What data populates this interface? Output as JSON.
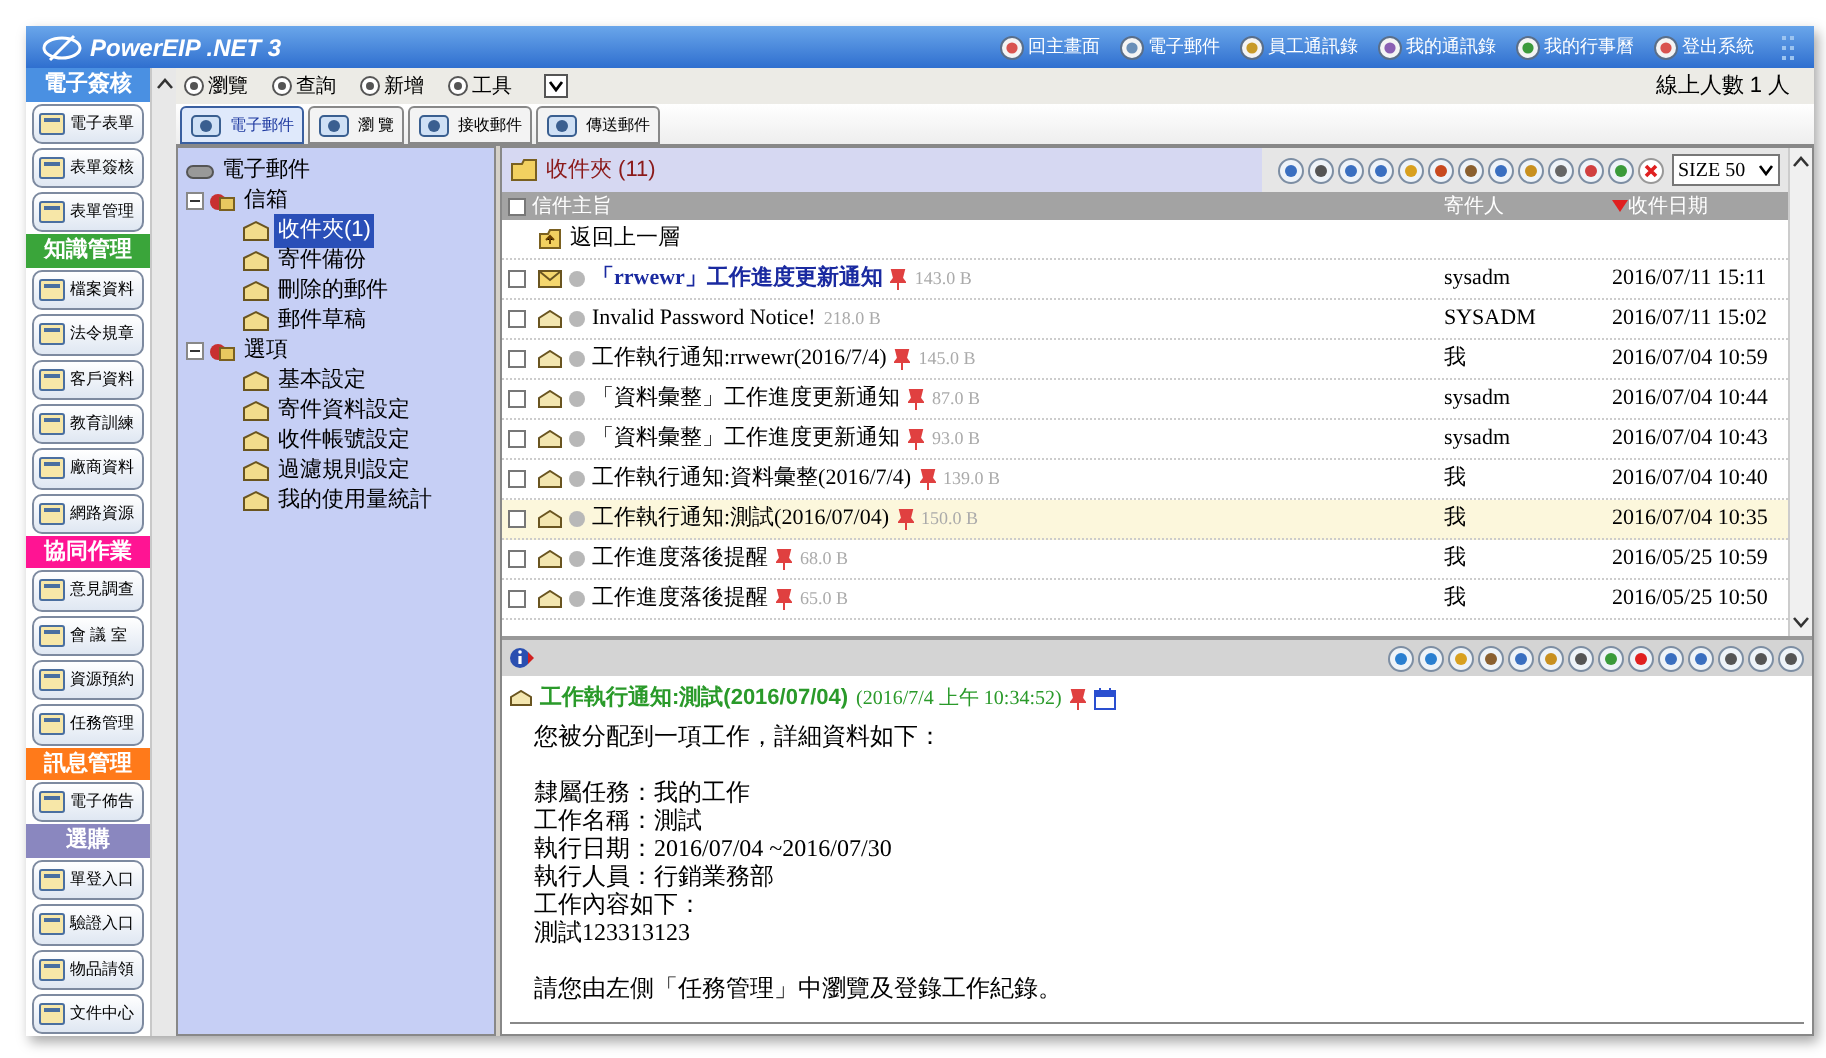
{
  "window": {
    "title": "PowerEIP .NET 3"
  },
  "top_links": [
    {
      "label": "回主畫面"
    },
    {
      "label": "電子郵件"
    },
    {
      "label": "員工通訊錄"
    },
    {
      "label": "我的通訊錄"
    },
    {
      "label": "我的行事曆"
    },
    {
      "label": "登出系統"
    }
  ],
  "online_count": "線上人數 1 人",
  "sidebar": {
    "sections": [
      {
        "title": "電子簽核",
        "color": "#4a90e2",
        "items": [
          "電子表單",
          "表單簽核",
          "表單管理"
        ]
      },
      {
        "title": "知識管理",
        "color": "#3aa53a",
        "items": [
          "檔案資料",
          "法令規章",
          "客戶資料",
          "教育訓練",
          "廠商資料",
          "網路資源"
        ]
      },
      {
        "title": "協同作業",
        "color": "#ff1493",
        "items": [
          "意見調查",
          "會 議 室",
          "資源預約",
          "任務管理"
        ]
      },
      {
        "title": "訊息管理",
        "color": "#ff7a1a",
        "items": [
          "電子佈告"
        ]
      },
      {
        "title": "選購",
        "color": "#8a87bf",
        "items": [
          "單登入口",
          "驗證入口",
          "物品請領",
          "文件中心"
        ]
      }
    ]
  },
  "menu": [
    {
      "label": "瀏覽"
    },
    {
      "label": "查詢"
    },
    {
      "label": "新增"
    },
    {
      "label": "工具"
    }
  ],
  "tabs": [
    {
      "label": "電子郵件",
      "selected": true
    },
    {
      "label": "瀏 覽",
      "selected": false
    },
    {
      "label": "接收郵件",
      "selected": false
    },
    {
      "label": "傳送郵件",
      "selected": false
    }
  ],
  "tree": [
    {
      "label": "電子郵件",
      "kind": "root",
      "children": [
        {
          "label": "信箱",
          "kind": "group",
          "expanded": true,
          "children": [
            {
              "label": "收件夾(1)",
              "kind": "leaf",
              "selected": true
            },
            {
              "label": "寄件備份",
              "kind": "leaf",
              "selected": false
            },
            {
              "label": "刪除的郵件",
              "kind": "leaf",
              "selected": false
            },
            {
              "label": "郵件草稿",
              "kind": "leaf",
              "selected": false
            }
          ]
        },
        {
          "label": "選項",
          "kind": "group",
          "expanded": true,
          "children": [
            {
              "label": "基本設定",
              "kind": "leaf",
              "selected": false
            },
            {
              "label": "寄件資料設定",
              "kind": "leaf",
              "selected": false
            },
            {
              "label": "收件帳號設定",
              "kind": "leaf",
              "selected": false
            },
            {
              "label": "過濾規則設定",
              "kind": "leaf",
              "selected": false
            },
            {
              "label": "我的使用量統計",
              "kind": "leaf",
              "selected": false
            }
          ]
        }
      ]
    }
  ],
  "mail_list": {
    "folder": "收件夾 (11)",
    "page_size": "SIZE 50",
    "columns": [
      "信件主旨",
      "寄件人",
      "收件日期"
    ],
    "up_row": "返回上一層",
    "select_all_checked": false,
    "rows": [
      {
        "subject": "「rrwewr」工作進度更新通知",
        "size": "143.0 B",
        "sender": "sysadm",
        "date": "2016/07/11 15:11",
        "unread": true,
        "pinned": true,
        "selected": false,
        "checked": false
      },
      {
        "subject": "Invalid Password Notice!",
        "size": "218.0 B",
        "sender": "SYSADM",
        "date": "2016/07/11 15:02",
        "unread": false,
        "pinned": false,
        "selected": false,
        "checked": false
      },
      {
        "subject": "工作執行通知:rrwewr(2016/7/4)",
        "size": "145.0 B",
        "sender": "我",
        "date": "2016/07/04 10:59",
        "unread": false,
        "pinned": true,
        "selected": false,
        "checked": false
      },
      {
        "subject": "「資料彙整」工作進度更新通知",
        "size": "87.0 B",
        "sender": "sysadm",
        "date": "2016/07/04 10:44",
        "unread": false,
        "pinned": true,
        "selected": false,
        "checked": false
      },
      {
        "subject": "「資料彙整」工作進度更新通知",
        "size": "93.0 B",
        "sender": "sysadm",
        "date": "2016/07/04 10:43",
        "unread": false,
        "pinned": true,
        "selected": false,
        "checked": false
      },
      {
        "subject": "工作執行通知:資料彙整(2016/7/4)",
        "size": "139.0 B",
        "sender": "我",
        "date": "2016/07/04 10:40",
        "unread": false,
        "pinned": true,
        "selected": false,
        "checked": false
      },
      {
        "subject": "工作執行通知:測試(2016/07/04)",
        "size": "150.0 B",
        "sender": "我",
        "date": "2016/07/04 10:35",
        "unread": false,
        "pinned": true,
        "selected": true,
        "checked": false
      },
      {
        "subject": "工作進度落後提醒",
        "size": "68.0 B",
        "sender": "我",
        "date": "2016/05/25 10:59",
        "unread": false,
        "pinned": true,
        "selected": false,
        "checked": false
      },
      {
        "subject": "工作進度落後提醒",
        "size": "65.0 B",
        "sender": "我",
        "date": "2016/05/25 10:50",
        "unread": false,
        "pinned": true,
        "selected": false,
        "checked": false
      }
    ]
  },
  "preview": {
    "subject": "工作執行通知:測試(2016/07/04)",
    "date": "(2016/7/4 上午 10:34:52)",
    "paragraphs": [
      [
        "您被分配到一項工作，詳細資料如下："
      ],
      [
        "隸屬任務：我的工作",
        "工作名稱：測試",
        "執行日期：2016/07/04 ~2016/07/30",
        "執行人員：行銷業務部",
        "工作內容如下：",
        "測試123313123"
      ],
      [
        "請您由左側「任務管理」中瀏覽及登錄工作紀錄。"
      ]
    ]
  }
}
